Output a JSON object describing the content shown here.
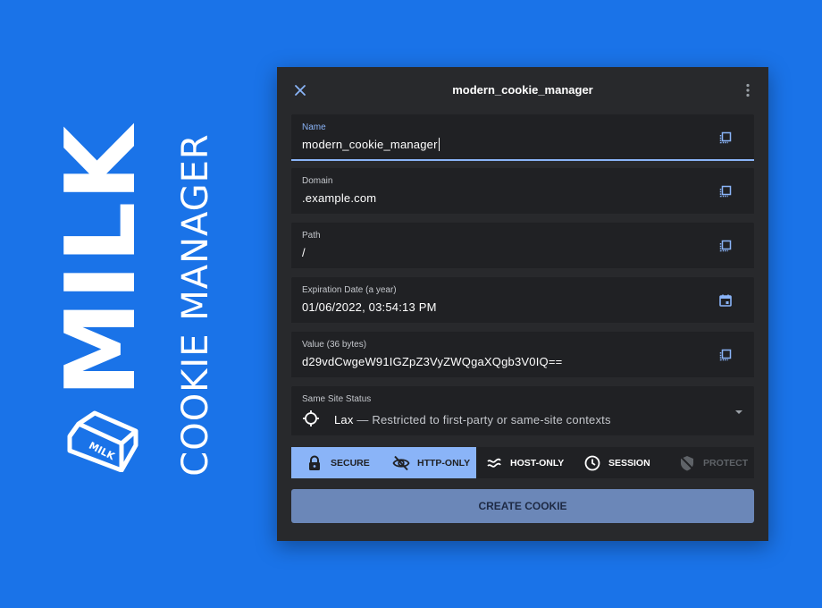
{
  "brand": {
    "name": "MILK",
    "subtitle": "COOKIE MANAGER",
    "logo_text": "MILK",
    "color": "#1a73e8"
  },
  "dialog": {
    "title": "modern_cookie_manager",
    "close_icon": "close-icon",
    "menu_icon": "more-vert-icon"
  },
  "fields": {
    "name": {
      "label": "Name",
      "value": "modern_cookie_manager",
      "icon": "copy-icon"
    },
    "domain": {
      "label": "Domain",
      "value": ".example.com",
      "icon": "copy-icon"
    },
    "path": {
      "label": "Path",
      "value": "/",
      "icon": "copy-icon"
    },
    "expiration": {
      "label": "Expiration Date (a year)",
      "value": "01/06/2022, 03:54:13 PM",
      "icon": "calendar-icon"
    },
    "value": {
      "label": "Value (36 bytes)",
      "value": "d29vdCwgeW91IGZpZ3VyZWQgaXQgb3V0IQ==",
      "icon": "copy-icon"
    },
    "samesite": {
      "label": "Same Site Status",
      "selected": "Lax",
      "description": " — Restricted to first-party or same-site contexts",
      "icon": "crosshair-icon"
    }
  },
  "toggles": {
    "secure": {
      "label": "SECURE",
      "on": true,
      "icon": "lock-icon"
    },
    "httponly": {
      "label": "HTTP-ONLY",
      "on": true,
      "icon": "eye-off-icon"
    },
    "hostonly": {
      "label": "HOST-ONLY",
      "on": false,
      "icon": "approx-icon"
    },
    "session": {
      "label": "SESSION",
      "on": false,
      "icon": "clock-icon"
    },
    "protect": {
      "label": "PROTECT",
      "on": false,
      "disabled": true,
      "icon": "shield-icon"
    }
  },
  "actions": {
    "create_label": "CREATE COOKIE"
  },
  "colors": {
    "accent": "#8ab4f8",
    "dialog_bg": "#28292c",
    "field_bg": "#202124",
    "create_button": "#6b87b8"
  }
}
